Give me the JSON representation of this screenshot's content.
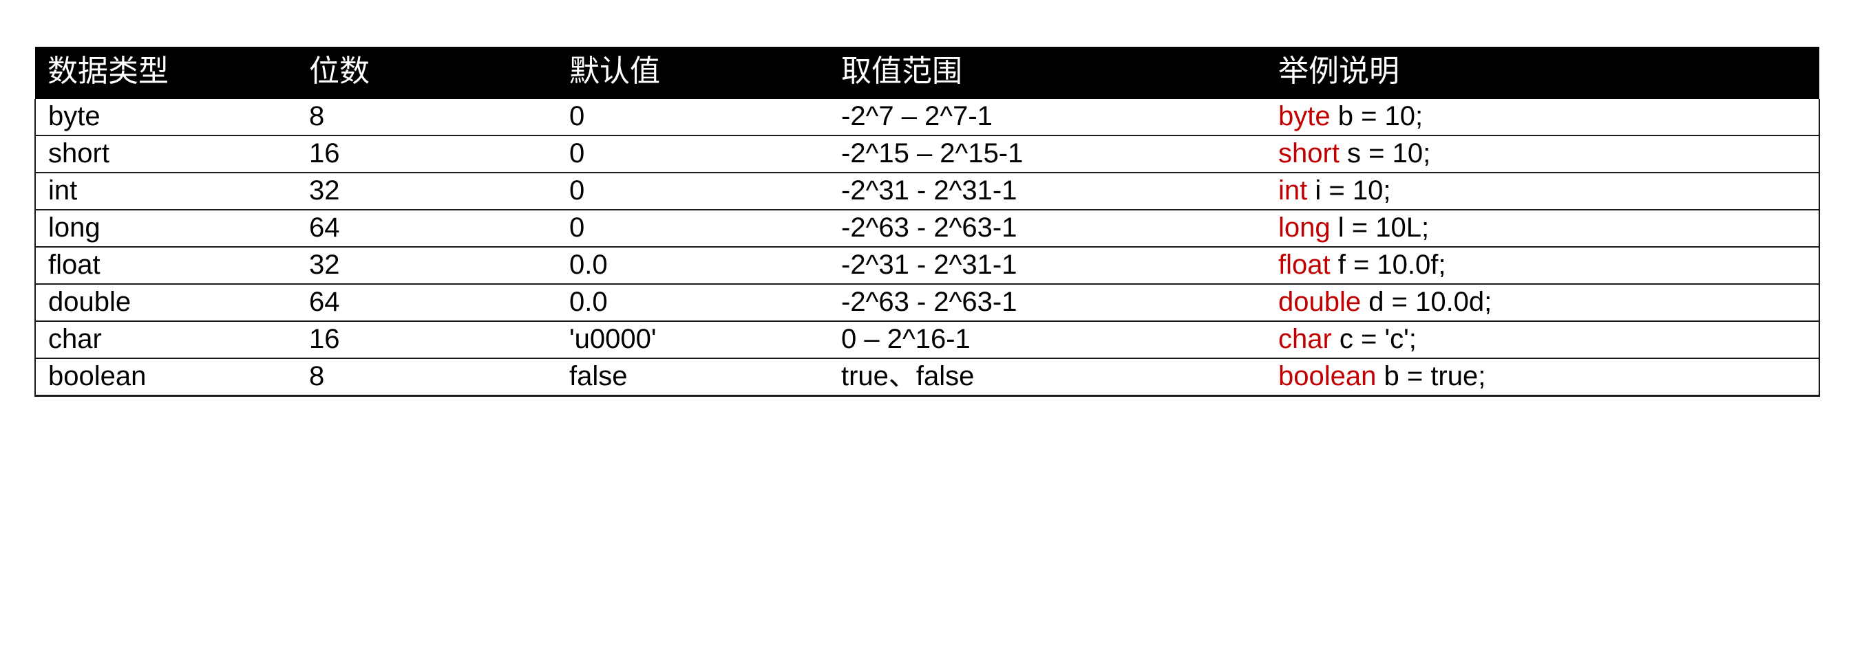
{
  "table": {
    "columns": [
      {
        "key": "type",
        "label": "数据类型"
      },
      {
        "key": "bits",
        "label": "位数"
      },
      {
        "key": "default",
        "label": "默认值"
      },
      {
        "key": "range",
        "label": "取值范围"
      },
      {
        "key": "example",
        "label": "举例说明"
      }
    ],
    "header_bg": "#000000",
    "header_fg": "#FFFFFF",
    "keyword_color": "#C00000",
    "body_fg": "#000000",
    "border_color": "#1A1A1A",
    "rows": [
      {
        "type": "byte",
        "bits": "8",
        "default": "0",
        "range": "-2^7 – 2^7-1",
        "example_keyword": "byte",
        "example_rest": " b = 10;",
        "example_full": "byte b = 10;"
      },
      {
        "type": "short",
        "bits": "16",
        "default": "0",
        "range": "-2^15 – 2^15-1",
        "example_keyword": "short",
        "example_rest": " s = 10;",
        "example_full": "short s = 10;"
      },
      {
        "type": "int",
        "bits": "32",
        "default": "0",
        "range": "-2^31 - 2^31-1",
        "example_keyword": "int",
        "example_rest": " i = 10;",
        "example_full": "int i = 10;"
      },
      {
        "type": "long",
        "bits": "64",
        "default": "0",
        "range": "-2^63 - 2^63-1",
        "example_keyword": "long",
        "example_rest": " l = 10L;",
        "example_full": "long l = 10L;"
      },
      {
        "type": "float",
        "bits": "32",
        "default": "0.0",
        "range": "-2^31 - 2^31-1",
        "example_keyword": "float",
        "example_rest": " f = 10.0f;",
        "example_full": "float f = 10.0f;"
      },
      {
        "type": "double",
        "bits": "64",
        "default": "0.0",
        "range": "-2^63 - 2^63-1",
        "example_keyword": "double",
        "example_rest": " d = 10.0d;",
        "example_full": "double d = 10.0d;"
      },
      {
        "type": "char",
        "bits": "16",
        "default": "'u0000'",
        "range": "0 – 2^16-1",
        "example_keyword": "char",
        "example_rest": " c = 'c';",
        "example_full": "char c = 'c';"
      },
      {
        "type": "boolean",
        "bits": "8",
        "default": "false",
        "range": "true、false",
        "example_keyword": "boolean",
        "example_rest": " b = true;",
        "example_full": "boolean b = true;"
      }
    ]
  }
}
